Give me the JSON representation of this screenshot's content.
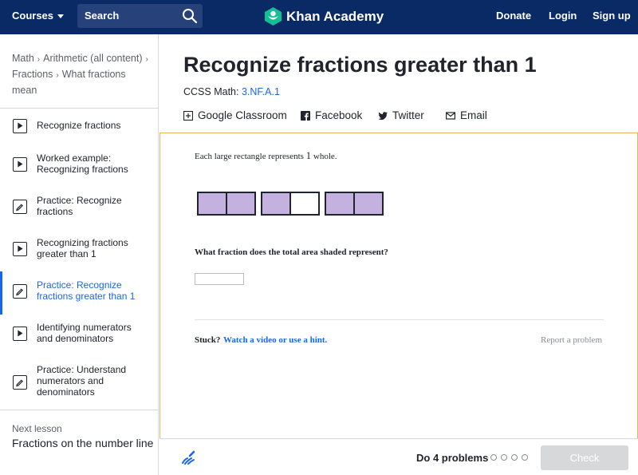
{
  "topnav": {
    "courses_label": "Courses",
    "search_placeholder": "Search",
    "logo_text": "Khan Academy",
    "donate_label": "Donate",
    "login_label": "Login",
    "signup_label": "Sign up",
    "colors": {
      "nav_bg": "#0a2a66",
      "accent": "#1865f2",
      "logo_green": "#14bf96"
    }
  },
  "sidebar": {
    "breadcrumbs": [
      "Math",
      "Arithmetic (all content)",
      "Fractions",
      "What fractions mean"
    ],
    "items": [
      {
        "label": "Recognize fractions",
        "icon": "play-icon",
        "active": false
      },
      {
        "label": "Worked example: Recognizing fractions",
        "icon": "play-icon",
        "active": false
      },
      {
        "label": "Practice: Recognize fractions",
        "icon": "pencil-icon",
        "active": false
      },
      {
        "label": "Recognizing fractions greater than 1",
        "icon": "play-icon",
        "active": false
      },
      {
        "label": "Practice: Recognize fractions greater than 1",
        "icon": "pencil-icon",
        "active": true
      },
      {
        "label": "Identifying numerators and denominators",
        "icon": "play-icon",
        "active": false
      },
      {
        "label": "Practice: Understand numerators and denominators",
        "icon": "pencil-icon",
        "active": false
      }
    ],
    "next_lesson_label": "Next lesson",
    "next_lesson_title": "Fractions on the number line"
  },
  "main": {
    "title": "Recognize fractions greater than 1",
    "ccss_prefix": "CCSS Math:",
    "ccss_code": "3.NF.A.1",
    "share": {
      "google_classroom": "Google Classroom",
      "facebook": "Facebook",
      "twitter": "Twitter",
      "email": "Email"
    }
  },
  "exercise": {
    "prompt_before": "Each large rectangle represents",
    "prompt_number": "1",
    "prompt_after": "whole.",
    "rectangles": [
      {
        "cells": [
          true,
          true
        ]
      },
      {
        "cells": [
          true,
          false
        ]
      },
      {
        "cells": [
          true,
          true
        ]
      }
    ],
    "question": "What fraction does the total area shaded represent?",
    "answer_value": "",
    "stuck_label": "Stuck?",
    "hint_link": "Watch a video or use a hint.",
    "report_label": "Report a problem",
    "colors": {
      "shaded": "#c5b1e0",
      "panel_border": "#e3b562"
    }
  },
  "footer": {
    "do_problems_label": "Do 4 problems",
    "progress_total": 4,
    "progress_done": 0,
    "check_label": "Check"
  }
}
